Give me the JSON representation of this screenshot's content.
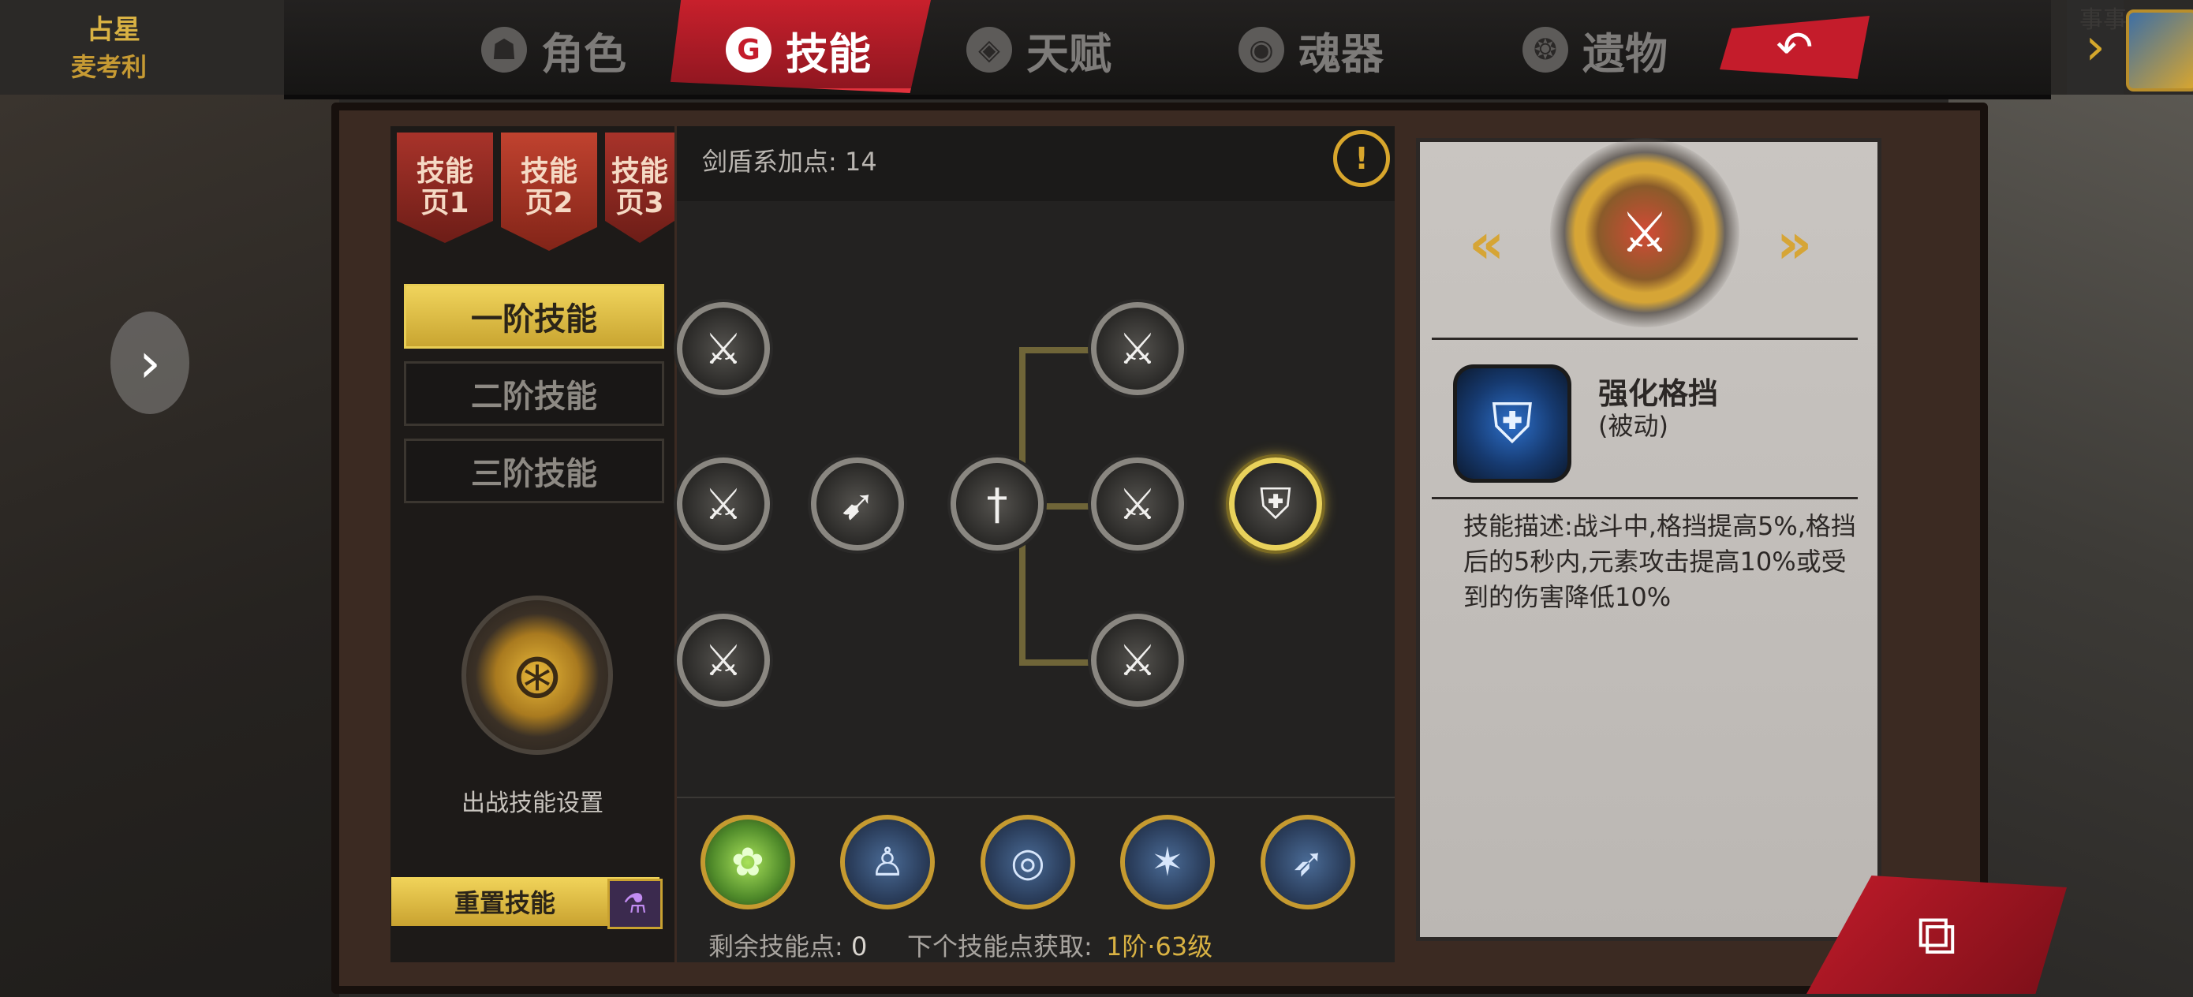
{
  "corner_left": {
    "line1": "占星",
    "line2": "麦考利"
  },
  "corner_right_text": "事事",
  "nav": {
    "tabs": [
      {
        "label": "角色",
        "icon": "helmet-icon",
        "active": false
      },
      {
        "label": "技能",
        "icon": "skill-swirl-icon",
        "active": true
      },
      {
        "label": "天赋",
        "icon": "talent-icon",
        "active": false
      },
      {
        "label": "魂器",
        "icon": "soul-vessel-icon",
        "active": false
      },
      {
        "label": "遗物",
        "icon": "relic-icon",
        "active": false
      }
    ],
    "back_icon": "back-arrow-icon"
  },
  "skill_pages": [
    {
      "label": "技能\n页1",
      "active": false
    },
    {
      "label": "技能\n页2",
      "active": true
    },
    {
      "label": "技能\n页3",
      "active": false,
      "locked": true
    }
  ],
  "tiers": [
    {
      "label": "一阶技能",
      "active": true
    },
    {
      "label": "二阶技能",
      "active": false
    },
    {
      "label": "三阶技能",
      "active": false
    }
  ],
  "battle_setup": {
    "label": "出战技能设置"
  },
  "reset": {
    "label": "重置技能"
  },
  "tree": {
    "points_label": "剑盾系加点: 14",
    "nodes": [
      {
        "name": "swordsman-strike-1",
        "selected": false
      },
      {
        "name": "swordsman-strike-2",
        "selected": false
      },
      {
        "name": "swordsman-strike-3",
        "selected": false
      },
      {
        "name": "wing-slash",
        "selected": false
      },
      {
        "name": "sword-root",
        "selected": false
      },
      {
        "name": "sword-branch-top",
        "selected": false
      },
      {
        "name": "sword-branch-mid",
        "selected": false
      },
      {
        "name": "sword-branch-bottom",
        "selected": false
      },
      {
        "name": "shield-lightning",
        "selected": true
      }
    ]
  },
  "bottom_skills": [
    {
      "icon": "green-orb-icon"
    },
    {
      "icon": "figure-aura-icon"
    },
    {
      "icon": "eye-rune-icon"
    },
    {
      "icon": "spirit-burst-icon"
    },
    {
      "icon": "dash-runner-icon"
    }
  ],
  "footer": {
    "remaining_label": "剩余技能点:",
    "remaining_value": "0",
    "next_label": "下个技能点获取:",
    "next_value": "1阶·63级"
  },
  "detail": {
    "name": "强化格挡",
    "type": "(被动)",
    "description": "技能描述:战斗中,格挡提高5%,格挡后的5秒内,元素攻击提高10%或受到的伤害降低10%"
  },
  "colors": {
    "accent_red": "#c41c2b",
    "accent_gold": "#e9d25b"
  }
}
